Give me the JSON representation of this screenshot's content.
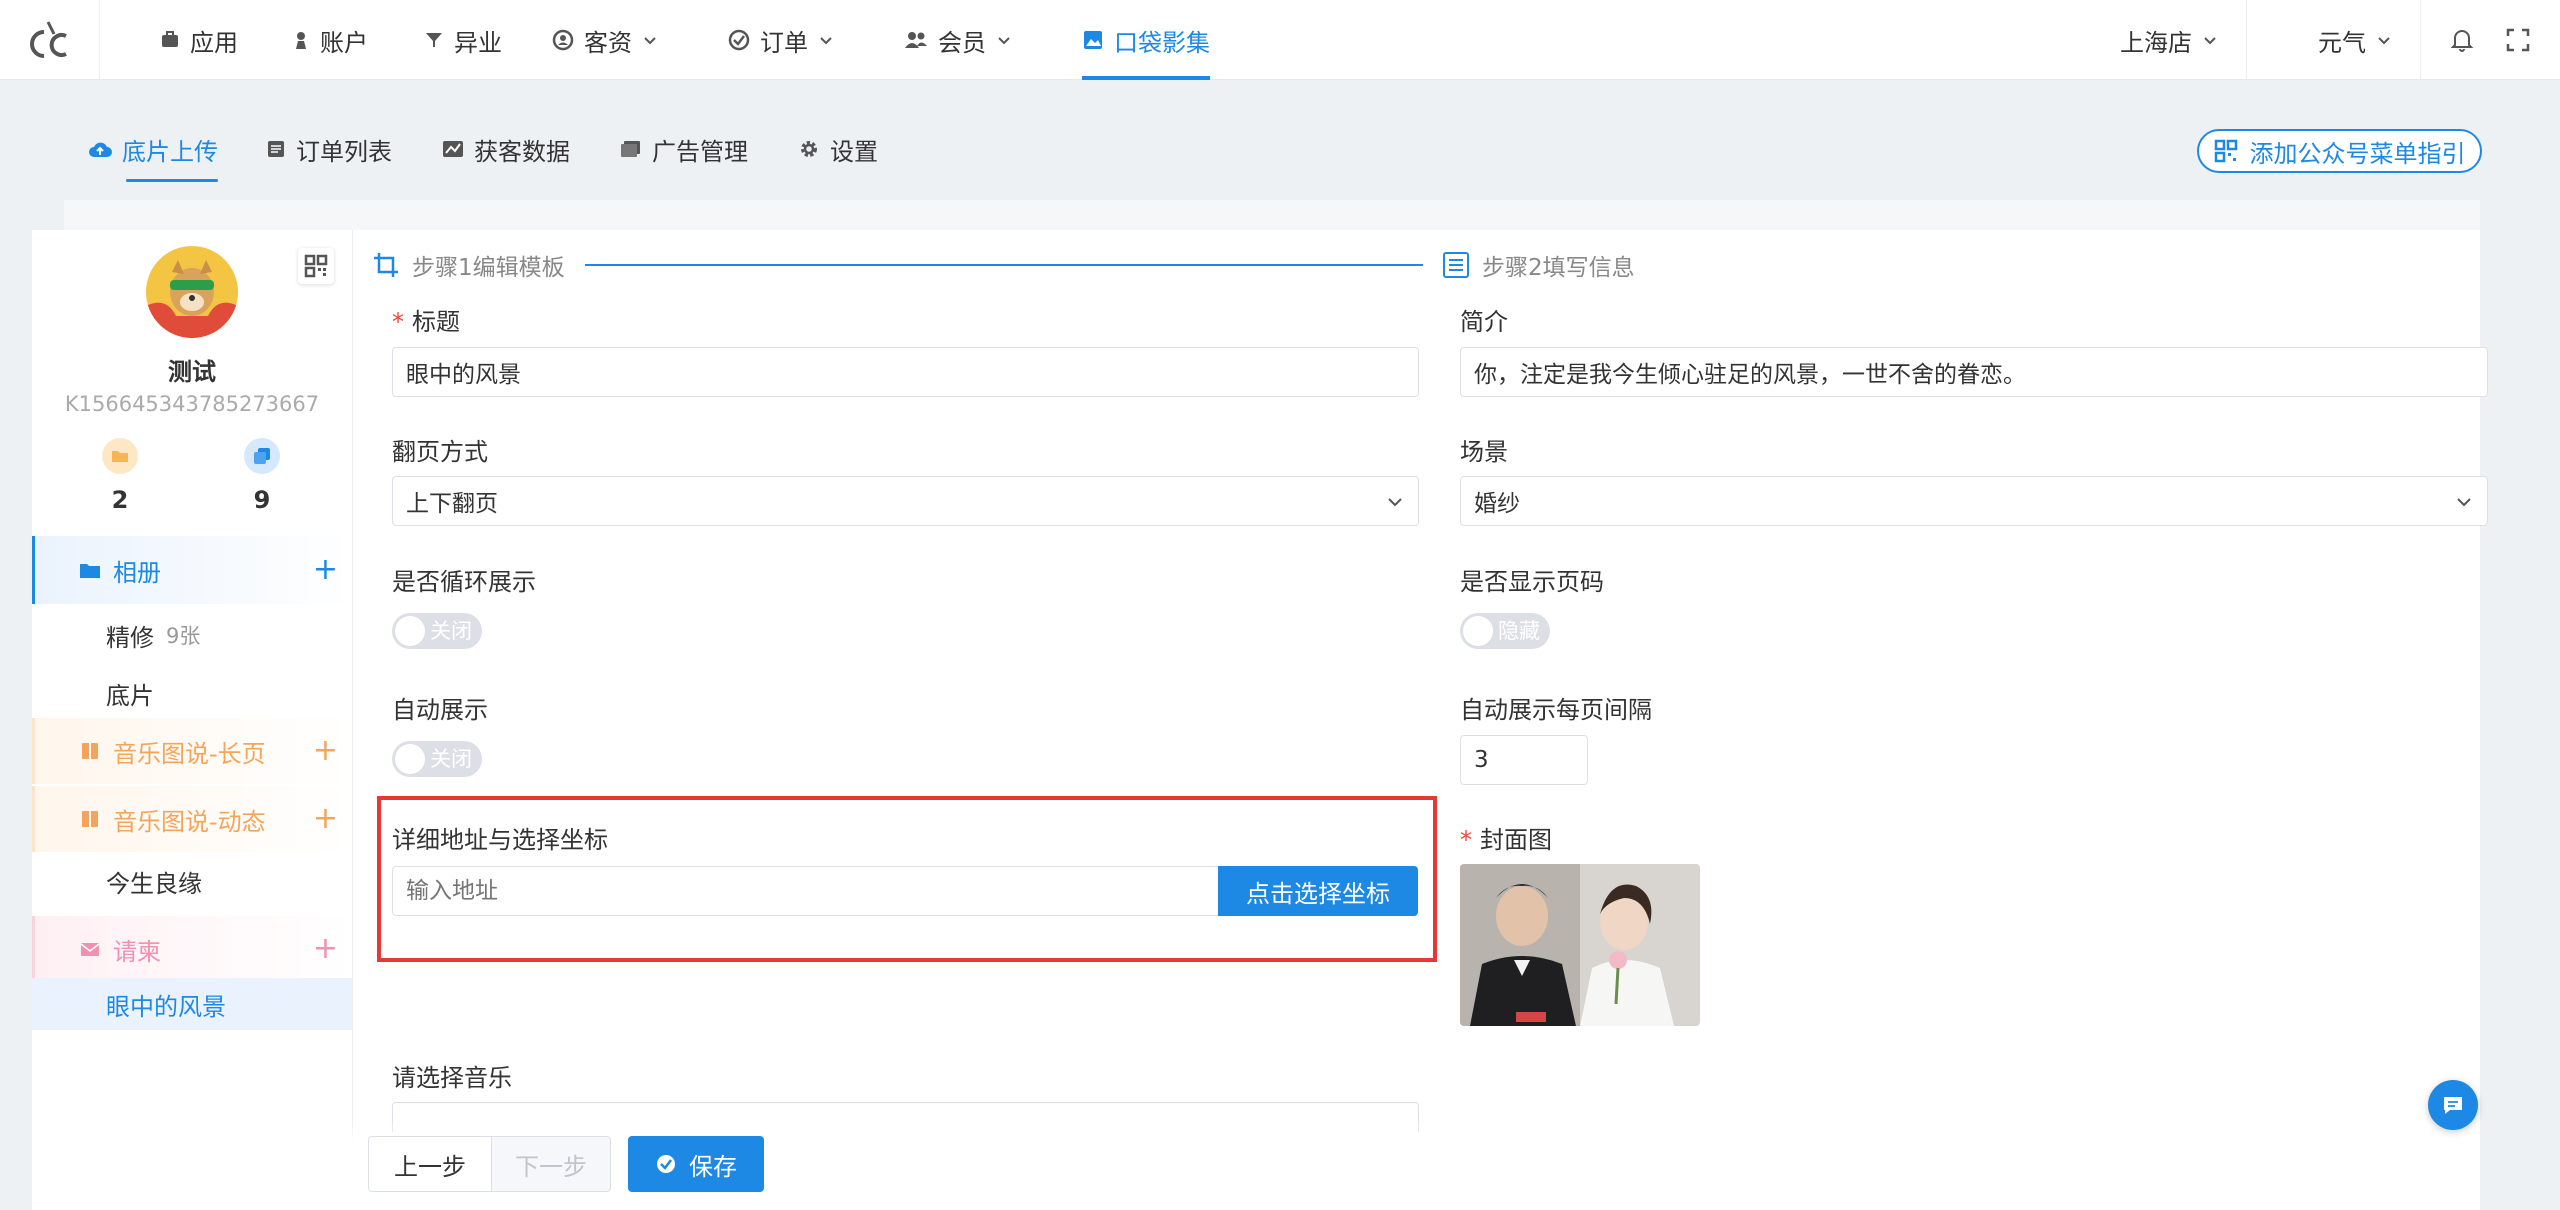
{
  "colors": {
    "accent": "#1e88e5",
    "required": "#f44336",
    "highlight": "#e53935",
    "orange": "#f5a55a",
    "pink": "#f48fb1"
  },
  "topnav": {
    "logo": "cc",
    "items": [
      {
        "label": "应用",
        "icon": "briefcase-icon"
      },
      {
        "label": "账户",
        "icon": "user-icon"
      },
      {
        "label": "异业",
        "icon": "filter-icon"
      },
      {
        "label": "客资",
        "icon": "customer-icon"
      },
      {
        "label": "订单",
        "icon": "check-circle-icon"
      },
      {
        "label": "会员",
        "icon": "members-icon"
      },
      {
        "label": "口袋影集",
        "icon": "photo-album-icon",
        "active": true
      }
    ],
    "store": "上海店",
    "user": "元气"
  },
  "subtabs": [
    {
      "label": "底片上传",
      "icon": "cloud-upload-icon",
      "active": true
    },
    {
      "label": "订单列表",
      "icon": "list-icon"
    },
    {
      "label": "获客数据",
      "icon": "chart-icon"
    },
    {
      "label": "广告管理",
      "icon": "ad-icon"
    },
    {
      "label": "设置",
      "icon": "gear-icon"
    }
  ],
  "guide_button": "添加公众号菜单指引",
  "sidebar": {
    "name": "测试",
    "id": "K156645343785273667",
    "stats": [
      {
        "value": "2"
      },
      {
        "value": "9"
      }
    ],
    "album": {
      "label": "相册"
    },
    "album_items": [
      {
        "label": "精修",
        "count": "9张"
      },
      {
        "label": "底片"
      }
    ],
    "music_long": "音乐图说-长页",
    "music_dynamic": "音乐图说-动态",
    "music_dynamic_items": [
      {
        "label": "今生良缘"
      }
    ],
    "invite": "请柬",
    "invite_items": [
      {
        "label": "眼中的风景"
      }
    ]
  },
  "steps": {
    "step1": "步骤1编辑模板",
    "step2": "步骤2填写信息"
  },
  "form": {
    "title_label": "标题",
    "title_value": "眼中的风景",
    "intro_label": "简介",
    "intro_value": "你，注定是我今生倾心驻足的风景，一世不舍的眷恋。",
    "flip_label": "翻页方式",
    "flip_value": "上下翻页",
    "scene_label": "场景",
    "scene_value": "婚纱",
    "loop_label": "是否循环展示",
    "loop_value": "关闭",
    "pagenum_label": "是否显示页码",
    "pagenum_value": "隐藏",
    "auto_label": "自动展示",
    "auto_value": "关闭",
    "interval_label": "自动展示每页间隔",
    "interval_value": "3",
    "address_label": "详细地址与选择坐标",
    "address_placeholder": "输入地址",
    "coord_button": "点击选择坐标",
    "cover_label": "封面图",
    "music_label": "请选择音乐"
  },
  "buttons": {
    "prev": "上一步",
    "next": "下一步",
    "save": "保存"
  }
}
